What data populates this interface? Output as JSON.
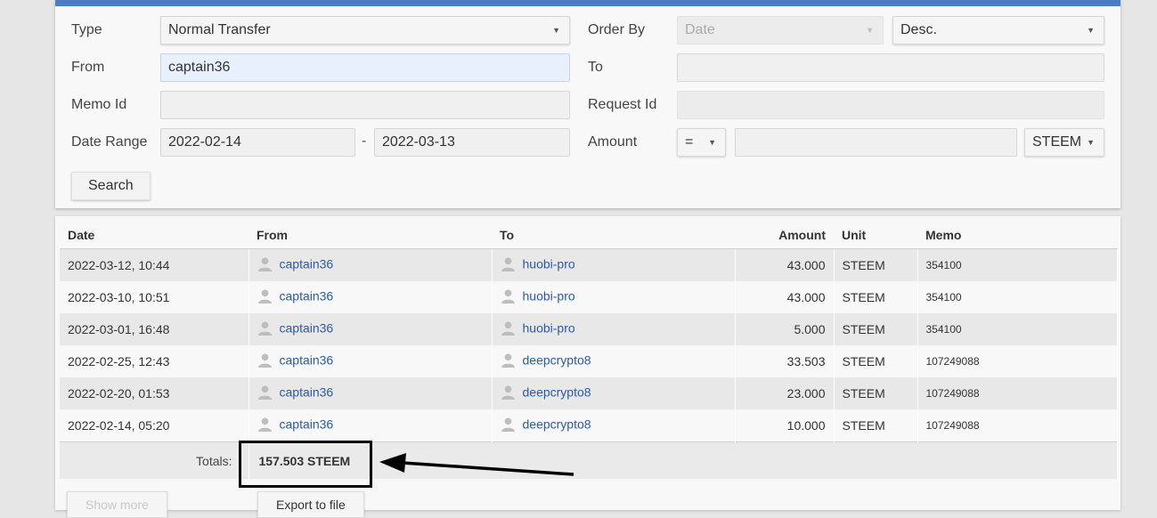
{
  "filters": {
    "type_label": "Type",
    "type_value": "Normal Transfer",
    "from_label": "From",
    "from_value": "captain36",
    "memo_label": "Memo Id",
    "memo_value": "",
    "date_label": "Date Range",
    "date_from": "2022-02-14",
    "date_sep": "-",
    "date_to": "2022-03-13",
    "order_label": "Order By",
    "order_value": "Date",
    "order_dir": "Desc.",
    "to_label": "To",
    "to_value": "",
    "request_label": "Request Id",
    "request_value": "",
    "amount_label": "Amount",
    "amount_op": "=",
    "amount_value": "",
    "amount_unit": "STEEM",
    "search_label": "Search"
  },
  "table": {
    "headers": [
      "Date",
      "From",
      "To",
      "Amount",
      "Unit",
      "Memo"
    ],
    "rows": [
      {
        "date": "2022-03-12, 10:44",
        "from": "captain36",
        "to": "huobi-pro",
        "amount": "43.000",
        "unit": "STEEM",
        "memo": "354100"
      },
      {
        "date": "2022-03-10, 10:51",
        "from": "captain36",
        "to": "huobi-pro",
        "amount": "43.000",
        "unit": "STEEM",
        "memo": "354100"
      },
      {
        "date": "2022-03-01, 16:48",
        "from": "captain36",
        "to": "huobi-pro",
        "amount": "5.000",
        "unit": "STEEM",
        "memo": "354100"
      },
      {
        "date": "2022-02-25, 12:43",
        "from": "captain36",
        "to": "deepcrypto8",
        "amount": "33.503",
        "unit": "STEEM",
        "memo": "107249088"
      },
      {
        "date": "2022-02-20, 01:53",
        "from": "captain36",
        "to": "deepcrypto8",
        "amount": "23.000",
        "unit": "STEEM",
        "memo": "107249088"
      },
      {
        "date": "2022-02-14, 05:20",
        "from": "captain36",
        "to": "deepcrypto8",
        "amount": "10.000",
        "unit": "STEEM",
        "memo": "107249088"
      }
    ],
    "totals_label": "Totals:",
    "totals_value": "157.503 STEEM"
  },
  "footer": {
    "show_more_label": "Show more",
    "export_label": "Export to file"
  },
  "icons": {
    "user": "user-icon",
    "dropdown": "caret-down-icon",
    "annotation": "arrow-left-icon"
  },
  "colors": {
    "accent": "#4a7ccc",
    "link": "#2a5aa8",
    "focused_field": "#e8f0fe"
  }
}
